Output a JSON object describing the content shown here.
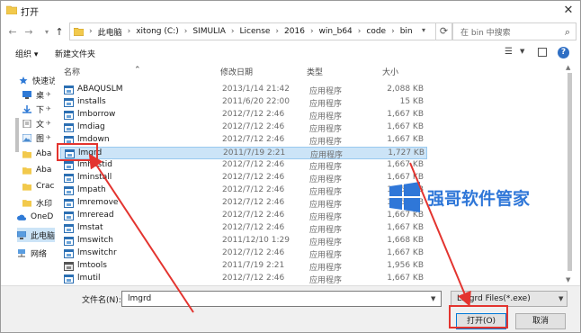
{
  "window": {
    "title": "打开"
  },
  "nav": {
    "back": "←",
    "forward": "→",
    "up": "↑"
  },
  "address": {
    "crumbs": [
      "此电脑",
      "xitong (C:)",
      "SIMULIA",
      "License",
      "2016",
      "win_b64",
      "code",
      "bin"
    ],
    "separator": "›"
  },
  "search": {
    "placeholder": "在 bin 中搜索"
  },
  "toolbar": {
    "organize": "组织 ▾",
    "new_folder": "新建文件夹"
  },
  "navpane": {
    "items": [
      {
        "label": "快速访",
        "icon": "star-icon",
        "pin": false
      },
      {
        "label": "桌",
        "icon": "desktop-icon",
        "pin": true
      },
      {
        "label": "下",
        "icon": "download-icon",
        "pin": true
      },
      {
        "label": "文",
        "icon": "document-icon",
        "pin": true
      },
      {
        "label": "图",
        "icon": "picture-icon",
        "pin": true
      },
      {
        "label": "Aba",
        "icon": "folder-icon",
        "pin": false
      },
      {
        "label": "Aba",
        "icon": "folder-icon",
        "pin": false
      },
      {
        "label": "Crac",
        "icon": "folder-icon",
        "pin": false
      },
      {
        "label": "水印",
        "icon": "folder-icon",
        "pin": false
      },
      {
        "label": "OneD",
        "icon": "cloud-icon",
        "pin": false
      },
      {
        "label": "此电脑",
        "icon": "computer-icon",
        "pin": false
      },
      {
        "label": "网络",
        "icon": "network-icon",
        "pin": false
      }
    ]
  },
  "columns": {
    "name": "名称",
    "date": "修改日期",
    "type": "类型",
    "size": "大小"
  },
  "files": [
    {
      "name": "ABAQUSLM",
      "date": "2013/1/14 21:42",
      "type": "应用程序",
      "size": "2,088 KB"
    },
    {
      "name": "installs",
      "date": "2011/6/20 22:00",
      "type": "应用程序",
      "size": "15 KB"
    },
    {
      "name": "lmborrow",
      "date": "2012/7/12 2:46",
      "type": "应用程序",
      "size": "1,667 KB"
    },
    {
      "name": "lmdiag",
      "date": "2012/7/12 2:46",
      "type": "应用程序",
      "size": "1,667 KB"
    },
    {
      "name": "lmdown",
      "date": "2012/7/12 2:46",
      "type": "应用程序",
      "size": "1,667 KB"
    },
    {
      "name": "lmgrd",
      "date": "2011/7/19 2:21",
      "type": "应用程序",
      "size": "1,727 KB"
    },
    {
      "name": "lmhostid",
      "date": "2012/7/12 2:46",
      "type": "应用程序",
      "size": "1,667 KB"
    },
    {
      "name": "lminstall",
      "date": "2012/7/12 2:46",
      "type": "应用程序",
      "size": "1,667 KB"
    },
    {
      "name": "lmpath",
      "date": "2012/7/12 2:46",
      "type": "应用程序",
      "size": "1,667 KB"
    },
    {
      "name": "lmremove",
      "date": "2012/7/12 2:46",
      "type": "应用程序",
      "size": "1,667 KB"
    },
    {
      "name": "lmreread",
      "date": "2012/7/12 2:46",
      "type": "应用程序",
      "size": "1,667 KB"
    },
    {
      "name": "lmstat",
      "date": "2012/7/12 2:46",
      "type": "应用程序",
      "size": "1,667 KB"
    },
    {
      "name": "lmswitch",
      "date": "2011/12/10 1:29",
      "type": "应用程序",
      "size": "1,668 KB"
    },
    {
      "name": "lmswitchr",
      "date": "2012/7/12 2:46",
      "type": "应用程序",
      "size": "1,667 KB"
    },
    {
      "name": "lmtools",
      "date": "2011/7/19 2:21",
      "type": "应用程序",
      "size": "1,956 KB"
    },
    {
      "name": "lmutil",
      "date": "2012/7/12 2:46",
      "type": "应用程序",
      "size": "1,667 KB"
    }
  ],
  "selected_file": "lmgrd",
  "footer": {
    "filename_label": "文件名(N):",
    "filename_value": "lmgrd",
    "filetype_value": "Lmgrd Files(*.exe)",
    "open_label": "打开(O)",
    "cancel_label": "取消"
  },
  "watermark": {
    "text": "强哥软件管家"
  },
  "colors": {
    "accent": "#0078d7",
    "selection": "#cce4f7",
    "annotation": "#e3342f",
    "watermark": "#2f77d8"
  }
}
